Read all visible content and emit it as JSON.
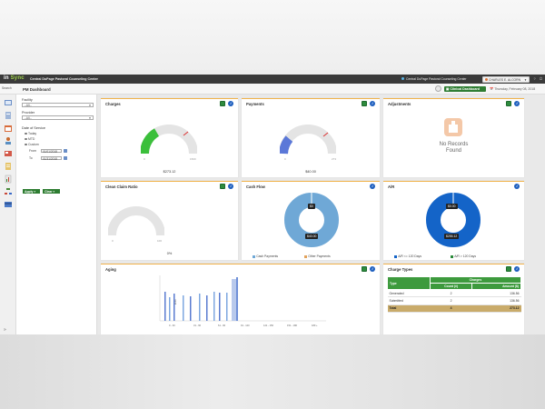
{
  "app": {
    "logo_prefix": "in",
    "logo_suffix": "Sync",
    "org_title": "Central DuPage Pastoral Counseling Center",
    "org_location": "Central DuPage Pastoral Counseling Center",
    "user_name": "CHARLES E. ALCORN"
  },
  "subbar": {
    "search_label": "Search",
    "page_title": "PM Dashboard",
    "clinical_dashboard_label": "Clinical Dashboard",
    "date_label": "Thursday, February 08, 2018"
  },
  "filters": {
    "facility_label": "Facility",
    "facility_value": "--All--",
    "provider_label": "Provider",
    "provider_value": "--All--",
    "dos_label": "Date of Service",
    "options": [
      "Today",
      "MTD",
      "Custom"
    ],
    "selected_option": "Custom",
    "from_label": "From",
    "from_value": "01/01/2018",
    "to_label": "To",
    "to_value": "01/31/2018",
    "apply_label": "Apply",
    "clear_label": "Clear"
  },
  "cards": {
    "charges": {
      "title": "Charges",
      "value": "$273.12",
      "min": "0",
      "max": "1500",
      "fill_fraction": 0.18,
      "color": "#3bbf3b"
    },
    "payments": {
      "title": "Payments",
      "value": "$40.00",
      "min": "0",
      "max": "273",
      "fill_fraction": 0.15,
      "color": "#5b78d8"
    },
    "adjustments": {
      "title": "Adjustments",
      "no_records_line1": "No Records",
      "no_records_line2": "Found"
    },
    "clean_claim": {
      "title": "Clean Claim Ratio",
      "value": "0%",
      "min": "0",
      "max": "100"
    },
    "cash_flow": {
      "title": "Cash Flow",
      "callout_top": "$0",
      "callout_center": "$40.00",
      "legend": [
        "Cash Payments",
        "Other Payments"
      ],
      "colors": [
        "#6fa8d6",
        "#e2a35c"
      ]
    },
    "ar": {
      "title": "A/R",
      "callout_top": "$0.00",
      "callout_center": "$255.12",
      "legend": [
        "A/R <= 120 Days",
        "A/R > 120 Days"
      ],
      "colors": [
        "#1464c8",
        "#2a8a3a"
      ]
    },
    "aging": {
      "title": "Aging",
      "bucket_labels": [
        "0 - 30",
        "31 - 60",
        "61 - 90",
        "91 - 120",
        "121 - 150",
        "151 - 180",
        "180 +"
      ]
    },
    "charge_types": {
      "title": "Charge Types",
      "group_header": "Charges",
      "col_type": "Type",
      "col_count": "Count (#)",
      "col_amount": "Amount ($)",
      "rows": [
        {
          "type": "Generated",
          "count": "2",
          "amount": "136.56"
        },
        {
          "type": "Submitted",
          "count": "2",
          "amount": "136.56"
        }
      ],
      "total": {
        "type": "Total",
        "count": "4",
        "amount": "273.12"
      }
    }
  },
  "icons": {
    "export": "export-excel-icon",
    "info": "info-icon"
  }
}
